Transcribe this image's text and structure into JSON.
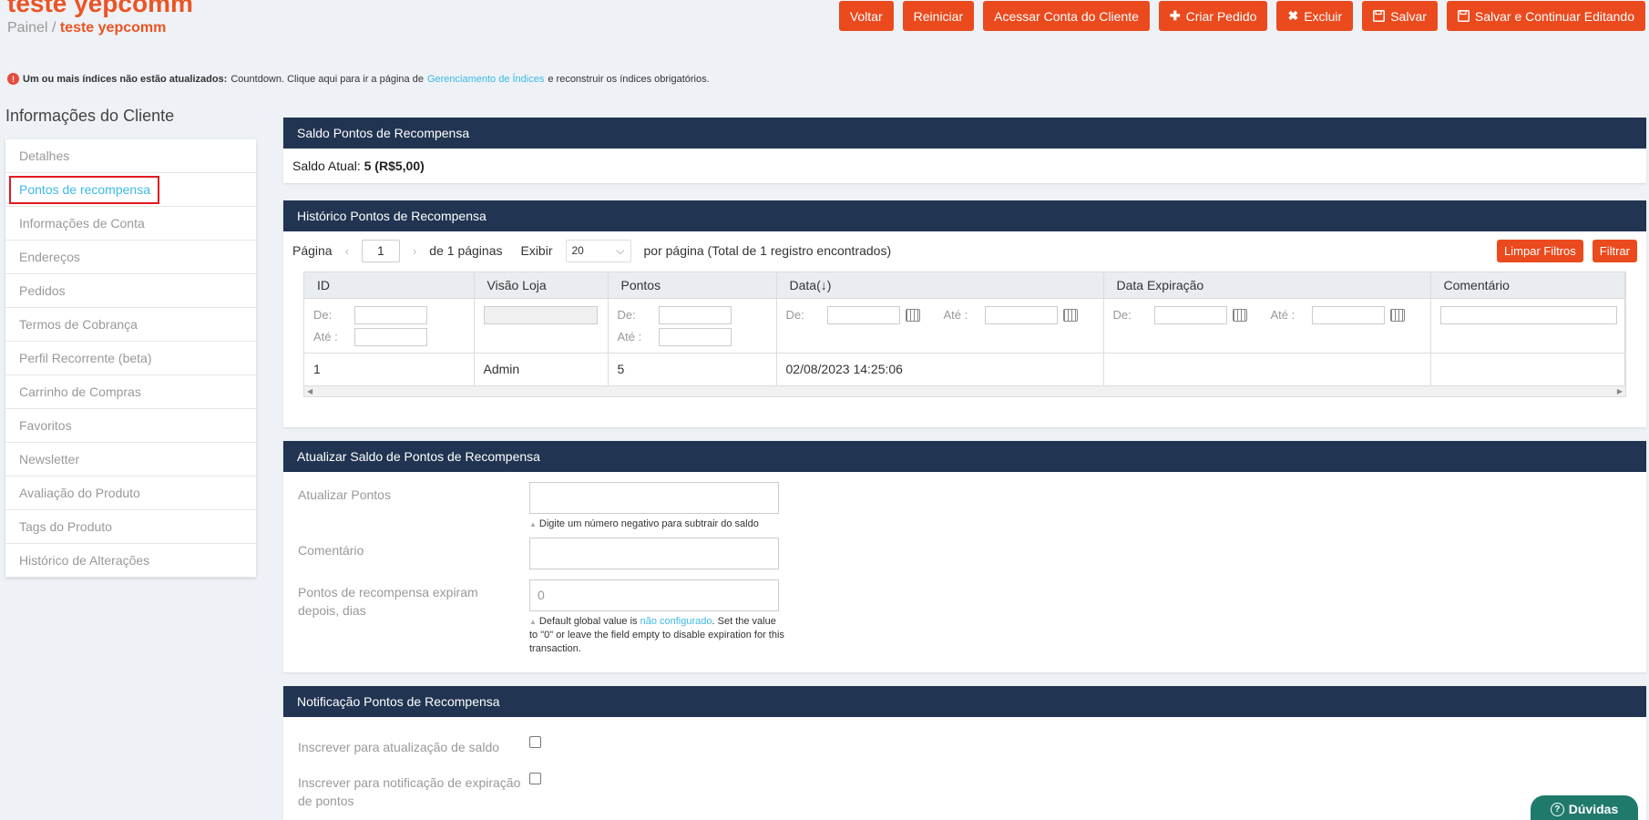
{
  "header": {
    "title": "teste yepcomm",
    "breadcrumb_root": "Painel",
    "breadcrumb_sep": "/",
    "breadcrumb_current": "teste yepcomm",
    "buttons": {
      "back": "Voltar",
      "reset": "Reiniciar",
      "access": "Acessar Conta do Cliente",
      "create_order": "Criar Pedido",
      "delete": "Excluir",
      "save": "Salvar",
      "save_continue": "Salvar e Continuar Editando"
    }
  },
  "notice": {
    "bold": "Um ou mais índices não estão atualizados:",
    "text1": "Countdown. Clique aqui para ir a página de",
    "link": "Gerenciamento de Índices",
    "text2": "e reconstruir os índices obrigatórios."
  },
  "sidebar": {
    "title": "Informações do Cliente",
    "items": [
      {
        "label": "Detalhes"
      },
      {
        "label": "Pontos de recompensa"
      },
      {
        "label": "Informações de Conta"
      },
      {
        "label": "Endereços"
      },
      {
        "label": "Pedidos"
      },
      {
        "label": "Termos de Cobrança"
      },
      {
        "label": "Perfil Recorrente (beta)"
      },
      {
        "label": "Carrinho de Compras"
      },
      {
        "label": "Favoritos"
      },
      {
        "label": "Newsletter"
      },
      {
        "label": "Avaliação do Produto"
      },
      {
        "label": "Tags do Produto"
      },
      {
        "label": "Histórico de Alterações"
      }
    ]
  },
  "balance": {
    "header": "Saldo Pontos de Recompensa",
    "label": "Saldo Atual:",
    "value": "5 (R$5,00)"
  },
  "history": {
    "header": "Histórico Pontos de Recompensa",
    "pager": {
      "page_label": "Página",
      "page_value": "1",
      "of_label": "de",
      "total_pages": "1",
      "pages_label": "páginas",
      "show_label": "Exibir",
      "per_page": "20",
      "per_page_text": "por página (Total de",
      "total_records": "1",
      "records_text": "registro encontrados)"
    },
    "reset_filters": "Limpar Filtros",
    "filter": "Filtrar",
    "columns": {
      "id": "ID",
      "store": "Visão Loja",
      "points": "Pontos",
      "date": "Data",
      "date_sort": "(↓)",
      "expire": "Data Expiração",
      "comment": "Comentário"
    },
    "filter_labels": {
      "from": "De:",
      "to": "Até :"
    },
    "rows": [
      {
        "id": "1",
        "store": "Admin",
        "points": "5",
        "date": "02/08/2023 14:25:06",
        "expire": "",
        "comment": ""
      }
    ]
  },
  "update": {
    "header": "Atualizar Saldo de Pontos de Recompensa",
    "points_label": "Atualizar Pontos",
    "points_hint": "Digite um número negativo para subtrair do saldo",
    "comment_label": "Comentário",
    "expire_label": "Pontos de recompensa expiram depois, dias",
    "expire_value": "0",
    "expire_hint1": "Default global value is",
    "expire_hint_link": "não configurado",
    "expire_hint2": ". Set the value to \"0\" or leave the field empty to disable expiration for this transaction."
  },
  "notification": {
    "header": "Notificação Pontos de Recompensa",
    "subscribe_update": "Inscrever para atualização de saldo",
    "subscribe_expire": "Inscrever para notificação de expiração de pontos"
  },
  "help": {
    "label": "Dúvidas"
  }
}
